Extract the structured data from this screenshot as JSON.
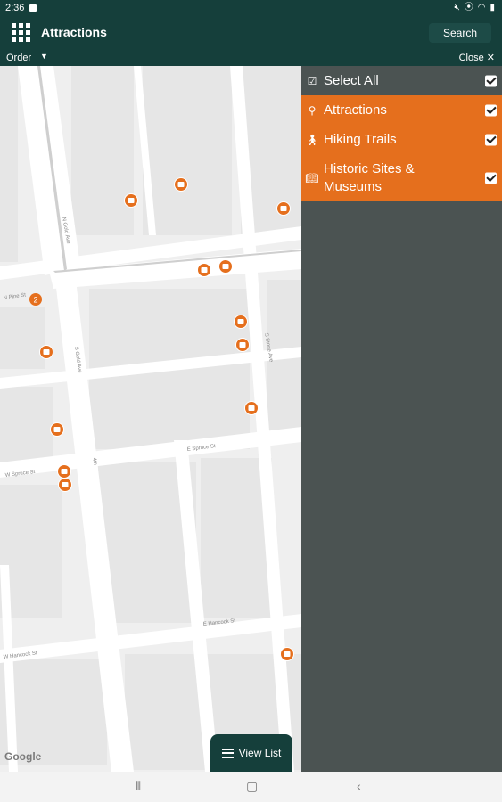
{
  "status": {
    "time": "2:36"
  },
  "header": {
    "title": "Attractions",
    "search_label": "Search"
  },
  "subbar": {
    "order_label": "Order",
    "close_label": "Close ✕"
  },
  "map": {
    "attribution": "Google",
    "street_labels": [
      "N Gold Ave",
      "N Pine St",
      "N Gold Ave",
      "S Gold Ave",
      "S Stone Ave",
      "E Spruce St",
      "W Spruce St",
      "4th",
      "E Hancock St",
      "W Hancock St"
    ],
    "cluster_count": "2",
    "marker_color": "#e56f1d"
  },
  "panel": {
    "select_all": "Select All",
    "categories": [
      {
        "label": "Attractions",
        "icon": "map-pin-icon"
      },
      {
        "label": "Hiking Trails",
        "icon": "hiker-icon"
      },
      {
        "label": "Historic Sites & Museums",
        "icon": "book-icon"
      }
    ]
  },
  "view_list": {
    "label": "View List"
  }
}
